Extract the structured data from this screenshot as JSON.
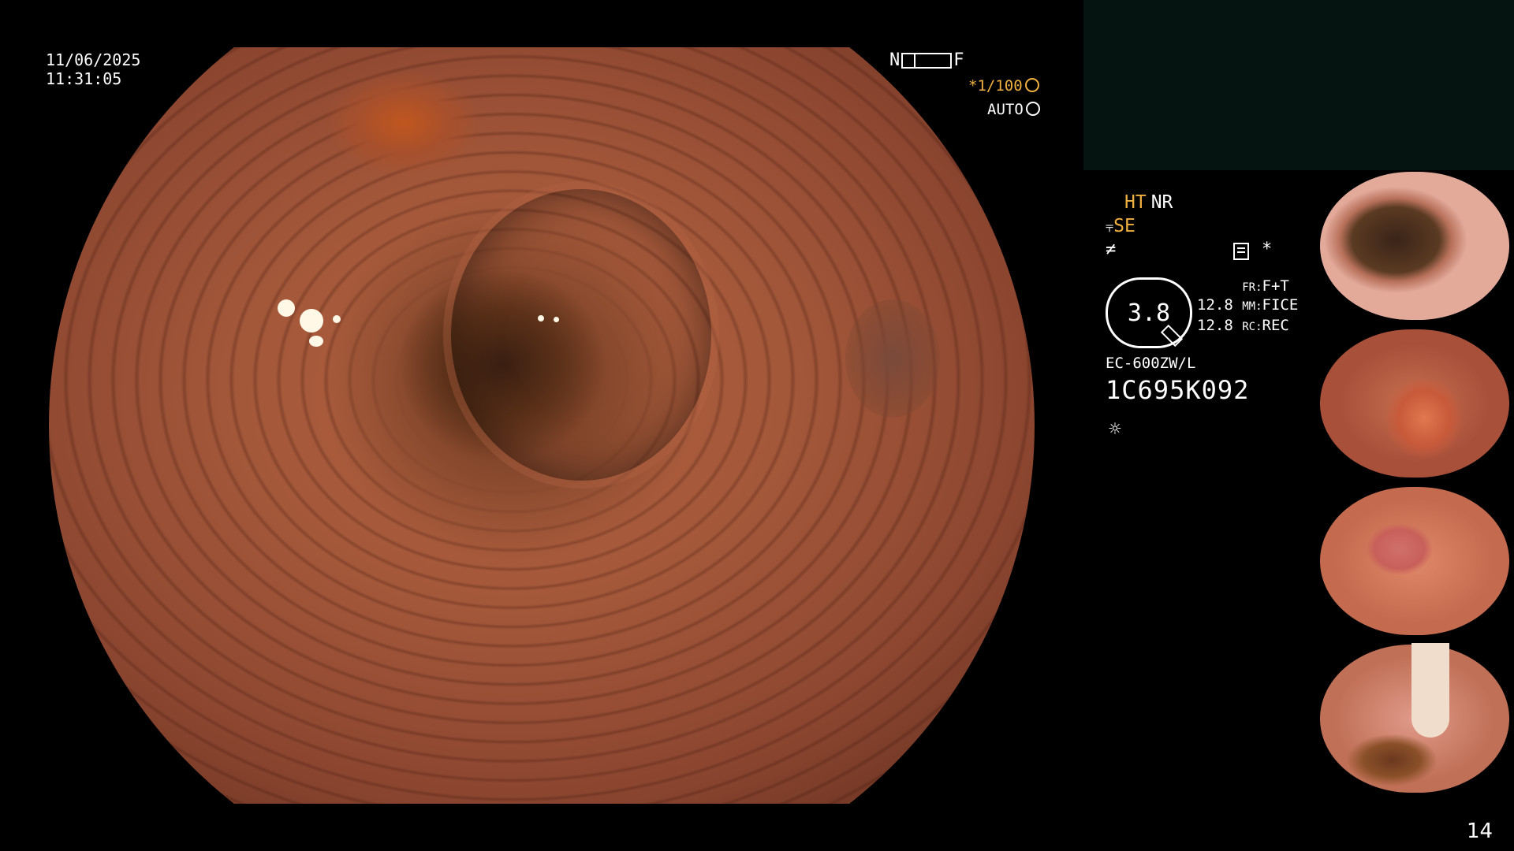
{
  "overlay": {
    "date": "11/06/2025",
    "time": "11:31:05",
    "focus": {
      "near": "N",
      "far": "F"
    },
    "shutter": "*1/100",
    "iris": "AUTO"
  },
  "settings": {
    "ht": "HT",
    "nr": "NR",
    "se": "SE",
    "se_symbol": "⫧",
    "f_symbol": "≠",
    "asterisk": "*",
    "zoom_value": "3.8",
    "fr_value": "12.8",
    "fr_label": "FR:",
    "fr_mode": "F+T",
    "mm_value": "12.8",
    "mm_label": "MM:",
    "mm_mode": "FICE",
    "rc_label": "RC:",
    "rc_mode": "REC",
    "scope_model": "EC-600ZW/L",
    "serial": "1C695K092",
    "light_symbol": "☼"
  },
  "thumbnails": [
    {
      "name": "thumbnail-1"
    },
    {
      "name": "thumbnail-2"
    },
    {
      "name": "thumbnail-3"
    },
    {
      "name": "thumbnail-4"
    }
  ],
  "page_number": "14",
  "colors": {
    "accent_orange": "#f0b040",
    "background": "#000000",
    "panel_dark_green": "#051410"
  }
}
